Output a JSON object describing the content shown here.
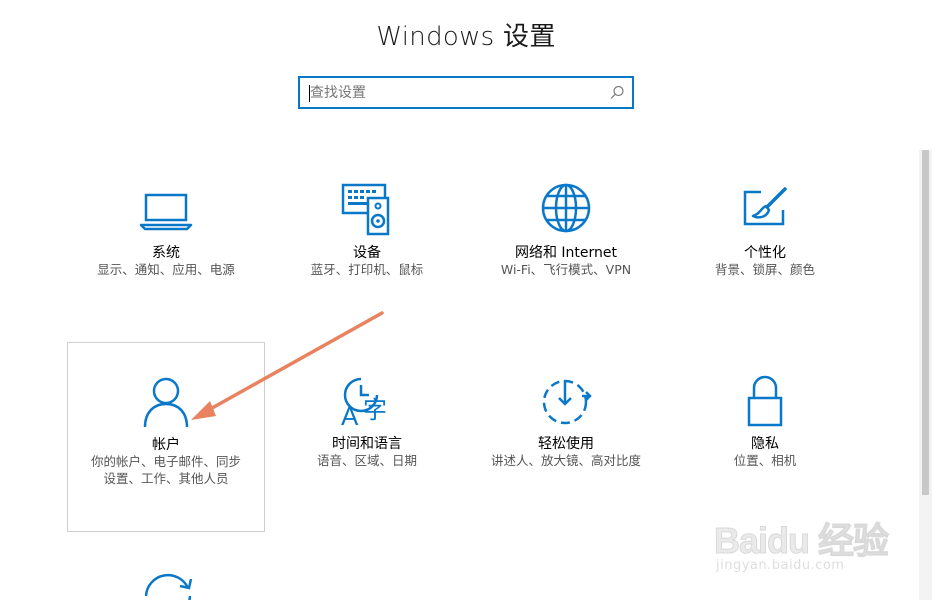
{
  "window": {
    "title": "Windows 设置"
  },
  "search": {
    "placeholder": "查找设置"
  },
  "tiles": [
    {
      "name": "系统",
      "desc": [
        "显示、通知、应用、电源"
      ],
      "icon": "laptop-icon"
    },
    {
      "name": "设备",
      "desc": [
        "蓝牙、打印机、鼠标"
      ],
      "icon": "keyboard-speaker-icon"
    },
    {
      "name": "网络和 Internet",
      "desc": [
        "Wi-Fi、飞行模式、VPN"
      ],
      "icon": "globe-icon"
    },
    {
      "name": "个性化",
      "desc": [
        "背景、锁屏、颜色"
      ],
      "icon": "paint-brush-icon"
    },
    {
      "name": "帐户",
      "desc": [
        "你的帐户、电子邮件、同步",
        "设置、工作、其他人员"
      ],
      "icon": "person-icon"
    },
    {
      "name": "时间和语言",
      "desc": [
        "语音、区域、日期"
      ],
      "icon": "time-language-icon"
    },
    {
      "name": "轻松使用",
      "desc": [
        "讲述人、放大镜、高对比度"
      ],
      "icon": "ease-of-access-icon"
    },
    {
      "name": "隐私",
      "desc": [
        "位置、相机"
      ],
      "icon": "lock-icon"
    }
  ],
  "watermark": {
    "main": "Baidu 经验",
    "sub": "jingyan.baidu.com"
  },
  "colors": {
    "accent": "#0a78c8",
    "annotation_arrow": "#e8825f"
  }
}
